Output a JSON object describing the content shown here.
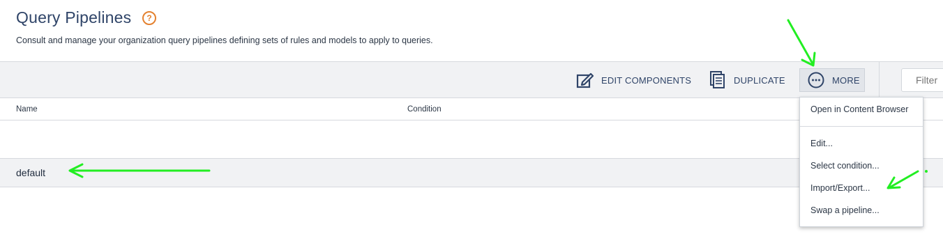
{
  "header": {
    "title": "Query Pipelines",
    "help_glyph": "?",
    "description": "Consult and manage your organization query pipelines defining sets of rules and models to apply to queries."
  },
  "toolbar": {
    "edit_components_label": "EDIT COMPONENTS",
    "duplicate_label": "DUPLICATE",
    "more_label": "MORE",
    "filter_placeholder": "Filter"
  },
  "table": {
    "columns": [
      "Name",
      "Condition"
    ],
    "rows": [
      {
        "name": "default",
        "condition": ""
      }
    ]
  },
  "more_menu": {
    "items": [
      "Open in Content Browser",
      "Edit...",
      "Select condition...",
      "Import/Export...",
      "Swap a pipeline..."
    ]
  },
  "colors": {
    "title": "#2f4468",
    "help_icon": "#e4812f",
    "toolbar_bg": "#f1f2f4",
    "annotation_arrow": "#22ee22"
  },
  "icons": [
    "help-icon",
    "edit-icon",
    "duplicate-icon",
    "more-icon"
  ]
}
